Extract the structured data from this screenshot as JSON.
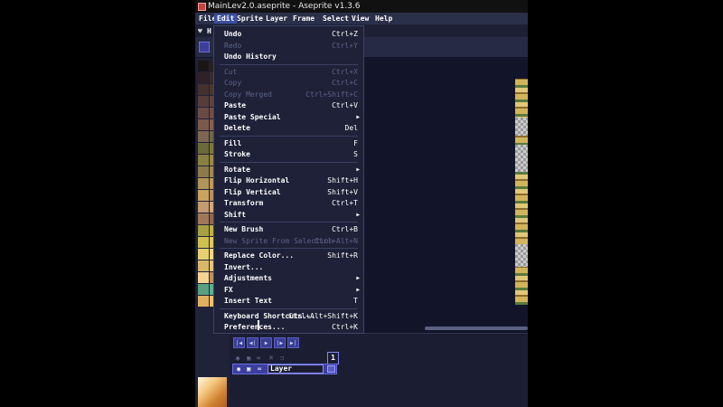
{
  "window": {
    "title": "MainLev2.0.aseprite - Aseprite v1.3.6"
  },
  "menubar": {
    "items": [
      "File",
      "Edit",
      "Sprite",
      "Layer",
      "Frame",
      "Select",
      "View",
      "Help"
    ],
    "active": "Edit"
  },
  "tabs": {
    "home_letter": "H"
  },
  "palette": {
    "colors": [
      "#1a1618",
      "#2a1e20",
      "#2e2226",
      "#3a2a2e",
      "#44302e",
      "#4a3634",
      "#563c3a",
      "#5e4440",
      "#6a4a44",
      "#724e48",
      "#7c5a4a",
      "#86604e",
      "#7e6650",
      "#6e6a48",
      "#6a6a3a",
      "#807a3a",
      "#8a8040",
      "#9a8a44",
      "#8c7a4a",
      "#a08a52",
      "#b09458",
      "#c09a58",
      "#c8a45c",
      "#b69068",
      "#c49a70",
      "#d0a878",
      "#a07858",
      "#8c6a50",
      "#a8a040",
      "#c0b040",
      "#d0c050",
      "#e0c860",
      "#e8d070",
      "#f0d880",
      "#d8b868",
      "#e8c478",
      "#f4d490",
      "#c09060",
      "#58a080",
      "#60b090",
      "#e0b060",
      "#f0c070"
    ]
  },
  "edit_menu": {
    "items": [
      {
        "label": "Undo",
        "shortcut": "Ctrl+Z",
        "enabled": true
      },
      {
        "label": "Redo",
        "shortcut": "Ctrl+Y",
        "enabled": false
      },
      {
        "label": "Undo History",
        "shortcut": "",
        "enabled": true
      },
      {
        "separator": true
      },
      {
        "label": "Cut",
        "shortcut": "Ctrl+X",
        "enabled": false
      },
      {
        "label": "Copy",
        "shortcut": "Ctrl+C",
        "enabled": false
      },
      {
        "label": "Copy Merged",
        "shortcut": "Ctrl+Shift+C",
        "enabled": false
      },
      {
        "label": "Paste",
        "shortcut": "Ctrl+V",
        "enabled": true
      },
      {
        "label": "Paste Special",
        "shortcut": "",
        "enabled": true,
        "submenu": true
      },
      {
        "label": "Delete",
        "shortcut": "Del",
        "enabled": true
      },
      {
        "separator": true
      },
      {
        "label": "Fill",
        "shortcut": "F",
        "enabled": true
      },
      {
        "label": "Stroke",
        "shortcut": "S",
        "enabled": true
      },
      {
        "separator": true
      },
      {
        "label": "Rotate",
        "shortcut": "",
        "enabled": true,
        "submenu": true
      },
      {
        "label": "Flip Horizontal",
        "shortcut": "Shift+H",
        "enabled": true
      },
      {
        "label": "Flip Vertical",
        "shortcut": "Shift+V",
        "enabled": true
      },
      {
        "label": "Transform",
        "shortcut": "Ctrl+T",
        "enabled": true
      },
      {
        "label": "Shift",
        "shortcut": "",
        "enabled": true,
        "submenu": true
      },
      {
        "separator": true
      },
      {
        "label": "New Brush",
        "shortcut": "Ctrl+B",
        "enabled": true
      },
      {
        "label": "New Sprite From Selection",
        "shortcut": "Ctrl+Alt+N",
        "enabled": false
      },
      {
        "separator": true
      },
      {
        "label": "Replace Color...",
        "shortcut": "Shift+R",
        "enabled": true
      },
      {
        "label": "Invert...",
        "shortcut": "",
        "enabled": true
      },
      {
        "label": "Adjustments",
        "shortcut": "",
        "enabled": true,
        "submenu": true
      },
      {
        "label": "FX",
        "shortcut": "",
        "enabled": true,
        "submenu": true
      },
      {
        "label": "Insert Text",
        "shortcut": "T",
        "enabled": true
      },
      {
        "separator": true
      },
      {
        "label": "Keyboard Shortcuts...",
        "shortcut": "Ctrl+Alt+Shift+K",
        "enabled": true
      },
      {
        "label": "Preferences...",
        "shortcut": "Ctrl+K",
        "enabled": true
      }
    ]
  },
  "timeline": {
    "controls": [
      "first-frame",
      "previous-frame",
      "play",
      "next-frame",
      "last-frame"
    ],
    "frame_number": "1",
    "layer_name": "Layer"
  }
}
